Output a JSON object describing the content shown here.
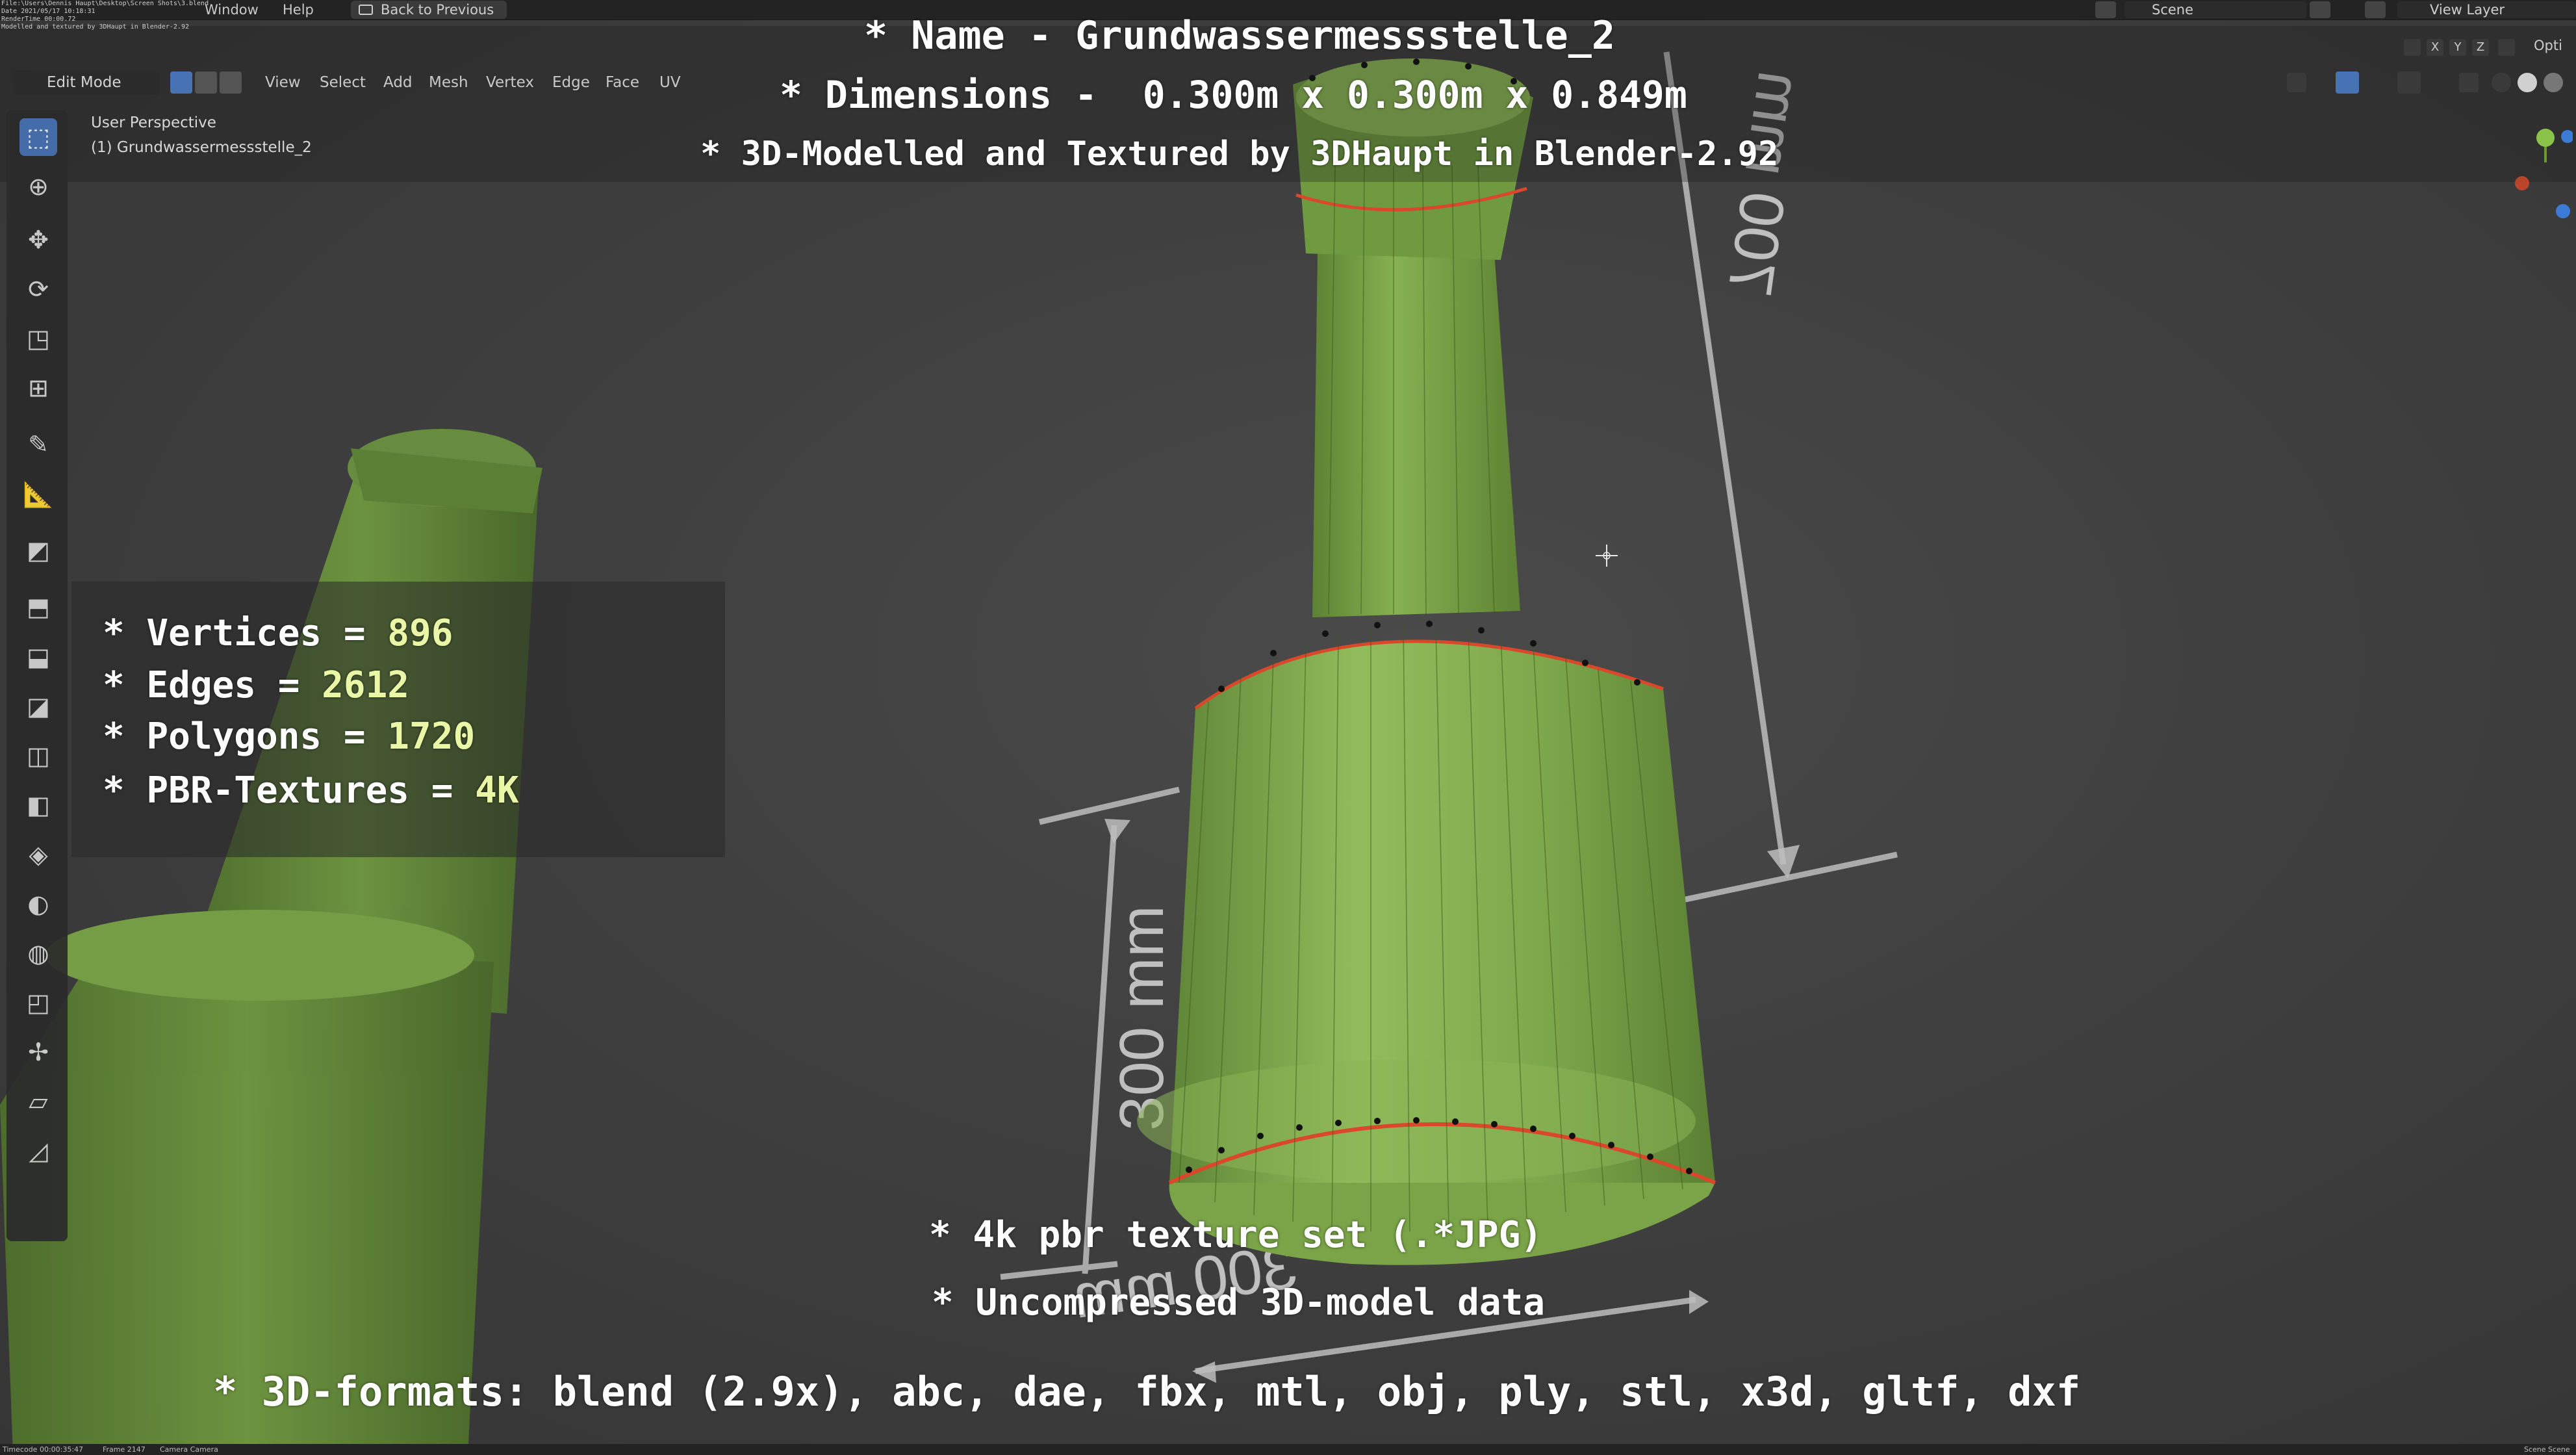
{
  "topbar": {
    "file_info_lines": [
      "File:\\Users\\Dennis Haupt\\Desktop\\Screen Shots\\3.blend",
      "Date 2021/05/17 10:18:31",
      "RenderTime 00:00.72",
      "Modelled and textured by 3DHaupt in Blender-2.92"
    ],
    "menus": [
      "Window",
      "Help"
    ],
    "back_button_label": "Back to Previous",
    "scene_label": "Scene",
    "view_layer_label": "View Layer",
    "options_label": "Opti"
  },
  "viewport_header": {
    "mode_label": "Edit Mode",
    "menus": [
      "View",
      "Select",
      "Add",
      "Mesh",
      "Vertex",
      "Edge",
      "Face",
      "UV"
    ],
    "active_select_mode": "vertex",
    "axis_labels": [
      "X",
      "Y",
      "Z"
    ]
  },
  "viewport": {
    "perspective_label": "User Perspective",
    "object_label": "(1) Grundwassermessstelle_2",
    "dimension_labels": [
      "700 mm",
      "300 mm",
      "300 mm"
    ]
  },
  "overlay": {
    "title_lines": [
      "* Name - Grundwassermessstelle_2",
      "* Dimensions -  0.300m x 0.300m x 0.849m",
      "* 3D-Modelled and Textured by 3DHaupt in Blender-2.92"
    ],
    "stats": [
      {
        "prefix": "* Vertices = ",
        "value": "896"
      },
      {
        "prefix": "* Edges = ",
        "value": "2612"
      },
      {
        "prefix": "* Polygons = ",
        "value": "1720"
      },
      {
        "prefix": "* PBR-Textures = ",
        "value": "4K"
      }
    ],
    "features": [
      "* 4k pbr texture set (.*JPG)",
      "* Uncompressed 3D-model data"
    ],
    "formats": "* 3D-formats: blend (2.9x), abc, dae, fbx, mtl, obj, ply, stl, x3d, gltf, dxf"
  },
  "statusbar": {
    "timecode": "Timecode 00:00:35:47",
    "frame": "Frame 2147",
    "camera": "Camera Camera",
    "right": "Scene Scene"
  },
  "colors": {
    "model_green": "#7fa84a",
    "edge_red": "#d9482a",
    "accent_blue": "#4772b3",
    "overlay_highlight": "#eaf7a6"
  },
  "toolbar_tools": [
    "select-box-icon",
    "cursor-icon",
    "move-icon",
    "rotate-icon",
    "scale-icon",
    "transform-icon",
    "annotate-icon",
    "measure-icon",
    "add-cube-icon",
    "extrude-icon",
    "inset-icon",
    "bevel-icon",
    "loop-cut-icon",
    "knife-icon",
    "poly-build-icon",
    "spin-icon",
    "smooth-icon",
    "edge-slide-icon",
    "shrink-fatten-icon",
    "shear-icon",
    "rip-icon"
  ]
}
